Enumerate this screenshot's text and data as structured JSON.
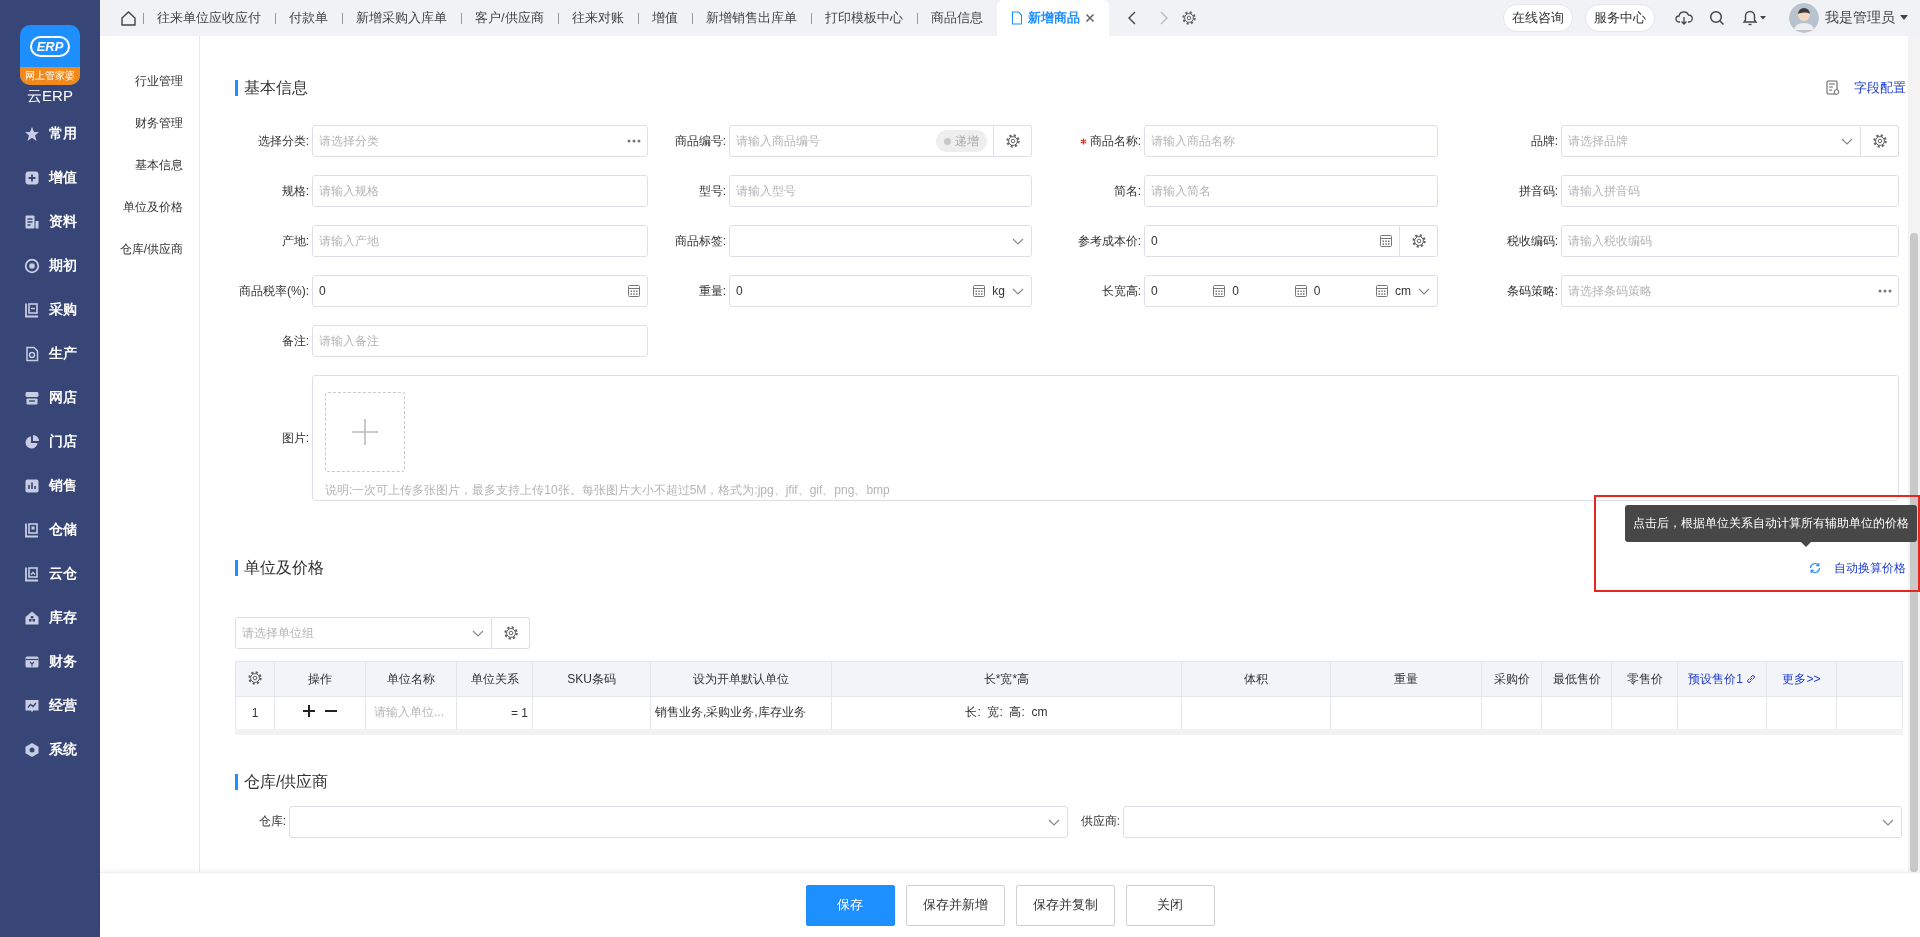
{
  "sidebar": {
    "logo_mark": "ERP",
    "logo_badge": "网上管家婆",
    "app_name": "云ERP",
    "items": [
      {
        "label": "常用"
      },
      {
        "label": "增值"
      },
      {
        "label": "资料"
      },
      {
        "label": "期初"
      },
      {
        "label": "采购"
      },
      {
        "label": "生产"
      },
      {
        "label": "网店"
      },
      {
        "label": "门店"
      },
      {
        "label": "销售"
      },
      {
        "label": "仓储"
      },
      {
        "label": "云仓"
      },
      {
        "label": "库存"
      },
      {
        "label": "财务"
      },
      {
        "label": "经营"
      },
      {
        "label": "系统"
      }
    ]
  },
  "tabs": [
    {
      "label": "往来单位应收应付",
      "selected": false
    },
    {
      "label": "付款单",
      "selected": false
    },
    {
      "label": "新增采购入库单",
      "selected": false
    },
    {
      "label": "客户/供应商",
      "selected": false
    },
    {
      "label": "往来对账",
      "selected": false
    },
    {
      "label": "增值",
      "selected": false
    },
    {
      "label": "新增销售出库单",
      "selected": false
    },
    {
      "label": "打印模板中心",
      "selected": false
    },
    {
      "label": "商品信息",
      "selected": false
    },
    {
      "label": "新增商品",
      "selected": true
    }
  ],
  "tab_nav": {
    "back_disabled": false,
    "forward_disabled": true
  },
  "header_buttons": [
    "在线咨询",
    "服务中心"
  ],
  "user": {
    "name": "我是管理员"
  },
  "section_nav": [
    "行业管理",
    "财务管理",
    "基本信息",
    "单位及价格",
    "仓库/供应商"
  ],
  "basic_info": {
    "title": "基本信息",
    "field_config": "字段配置",
    "fields": [
      {
        "label": "选择分类:",
        "kind": "picker",
        "placeholder": "请选择分类",
        "required": false
      },
      {
        "label": "商品编号:",
        "kind": "code",
        "placeholder": "请输入商品编号",
        "required": false,
        "toggle": {
          "label": "递增",
          "on": false
        }
      },
      {
        "label": "商品名称:",
        "kind": "text",
        "placeholder": "请输入商品名称",
        "required": true
      },
      {
        "label": "品牌:",
        "kind": "select_gear",
        "placeholder": "请选择品牌",
        "required": false
      },
      {
        "label": "规格:",
        "kind": "text",
        "placeholder": "请输入规格",
        "required": false
      },
      {
        "label": "型号:",
        "kind": "text",
        "placeholder": "请输入型号",
        "required": false
      },
      {
        "label": "简名:",
        "kind": "text",
        "placeholder": "请输入简名",
        "required": false
      },
      {
        "label": "拼音码:",
        "kind": "text",
        "placeholder": "请输入拼音码",
        "required": false
      },
      {
        "label": "产地:",
        "kind": "text",
        "placeholder": "请输入产地",
        "required": false
      },
      {
        "label": "商品标签:",
        "kind": "select",
        "required": false
      },
      {
        "label": "参考成本价:",
        "kind": "number_gear",
        "value": "0",
        "required": false
      },
      {
        "label": "税收编码:",
        "kind": "text",
        "placeholder": "请输入税收编码",
        "required": false
      },
      {
        "label": "商品税率(%):",
        "kind": "number",
        "value": "0",
        "required": false
      },
      {
        "label": "重量:",
        "kind": "weight",
        "value": "0",
        "unit": "kg",
        "required": false
      },
      {
        "label": "长宽高:",
        "kind": "dims",
        "values": [
          "0",
          "0",
          "0"
        ],
        "unit": "cm",
        "required": false
      },
      {
        "label": "条码策略:",
        "kind": "picker",
        "placeholder": "请选择条码策略",
        "required": false
      },
      {
        "label": "备注:",
        "kind": "text",
        "placeholder": "请输入备注",
        "required": false
      }
    ],
    "images": {
      "label": "图片:",
      "note": "说明:一次可上传多张图片，最多支持上传10张。每张图片大小不超过5M，格式为:jpg、jfif、gif、png、bmp"
    }
  },
  "units": {
    "title": "单位及价格",
    "tooltip": "点击后，根据单位关系自动计算所有辅助单位的价格",
    "auto_link": "自动换算价格",
    "group_placeholder": "请选择单位组",
    "columns": [
      {
        "label": "操作",
        "kind": "text"
      },
      {
        "label": "单位名称",
        "kind": "text"
      },
      {
        "label": "单位关系",
        "kind": "text"
      },
      {
        "label": "SKU条码",
        "kind": "text"
      },
      {
        "label": "设为开单默认单位",
        "kind": "text"
      },
      {
        "label": "长*宽*高",
        "kind": "text"
      },
      {
        "label": "体积",
        "kind": "text"
      },
      {
        "label": "重量",
        "kind": "text"
      },
      {
        "label": "采购价",
        "kind": "text"
      },
      {
        "label": "最低售价",
        "kind": "text"
      },
      {
        "label": "零售价",
        "kind": "text"
      },
      {
        "label": "预设售价1",
        "kind": "chain_link"
      },
      {
        "label": "更多>>",
        "kind": "link"
      }
    ],
    "rows": [
      {
        "index": "1",
        "unit_placeholder": "请输入单位...",
        "relation": "= 1",
        "default_unit": "销售业务,采购业务,库存业务",
        "dims": "长:  宽:  高:  cm"
      }
    ]
  },
  "warehouse": {
    "title": "仓库/供应商",
    "fields": [
      {
        "label": "仓库:"
      },
      {
        "label": "供应商:"
      }
    ]
  },
  "footer": {
    "buttons": [
      {
        "label": "保存",
        "kind": "primary"
      },
      {
        "label": "保存并新增",
        "kind": "default"
      },
      {
        "label": "保存并复制",
        "kind": "default"
      },
      {
        "label": "关闭",
        "kind": "default"
      }
    ]
  }
}
